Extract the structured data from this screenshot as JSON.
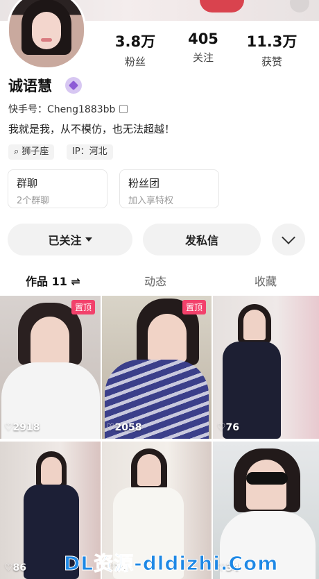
{
  "profile": {
    "name": "诚语慧",
    "kuaishou_id": "快手号：Cheng1883bb",
    "bio": "我就是我，从不模仿，也无法超越！",
    "tags": [
      "狮子座",
      "IP：河北"
    ]
  },
  "stats": [
    {
      "value": "3.8万",
      "label": "粉丝"
    },
    {
      "value": "405",
      "label": "关注"
    },
    {
      "value": "11.3万",
      "label": "获赞"
    }
  ],
  "cards": [
    {
      "title": "群聊",
      "subtitle": "2个群聊"
    },
    {
      "title": "粉丝团",
      "subtitle": "加入享特权"
    }
  ],
  "actions": {
    "follow": "已关注",
    "message": "发私信"
  },
  "tabs": [
    "作品 11 ⇌",
    "动态",
    "收藏"
  ],
  "videos": [
    {
      "likes": "♡2918",
      "pinned": "置顶"
    },
    {
      "likes": "♡2058",
      "pinned": "置顶"
    },
    {
      "likes": "♡76"
    },
    {
      "likes": "♡86"
    },
    {
      "likes": "♡74"
    },
    {
      "likes": "♡34"
    }
  ],
  "watermark": "DL资源-dldizhi.Com",
  "colors": {
    "accent": "#f2416b",
    "badge": "#8c5bd6"
  }
}
